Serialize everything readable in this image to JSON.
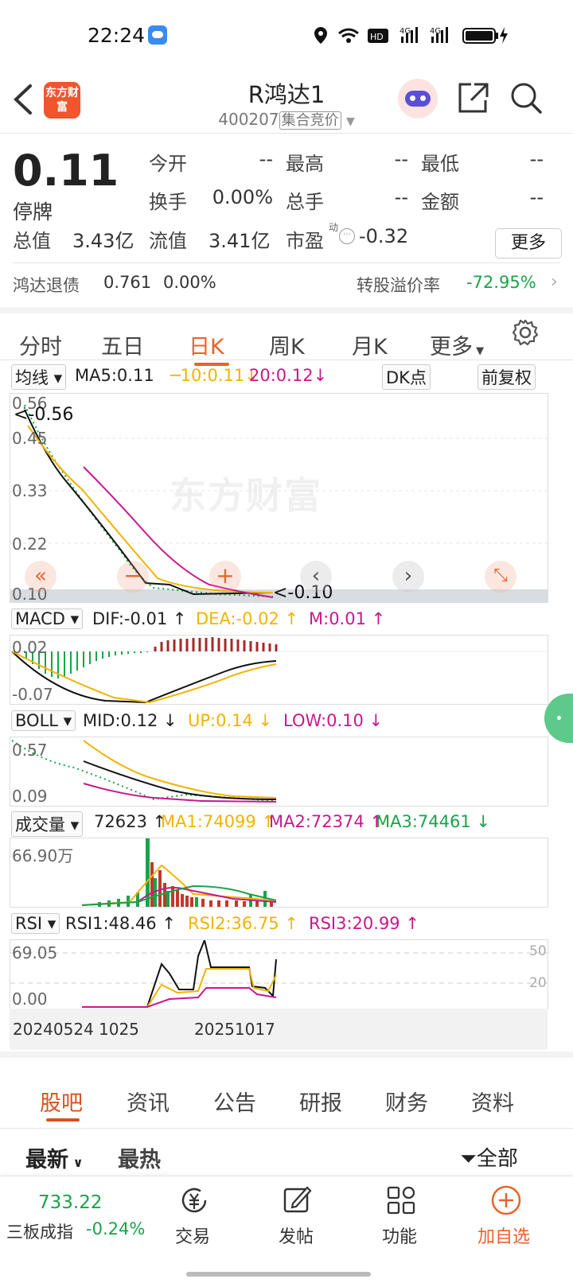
{
  "status_bar": {
    "time": "22:24"
  },
  "header": {
    "title": "R鸿达1",
    "code": "400207",
    "tag": "集合竞价",
    "logo_text": "东方财富"
  },
  "quote": {
    "price": "0.11",
    "state": "停牌",
    "open_label": "今开",
    "open": "--",
    "high_label": "最高",
    "high": "--",
    "low_label": "最低",
    "low": "--",
    "turnover_label": "换手",
    "turnover": "0.00%",
    "volume_label": "总手",
    "volume": "--",
    "amount_label": "金额",
    "amount": "--",
    "mktcap_label": "总值",
    "mktcap": "3.43亿",
    "float_label": "流值",
    "float": "3.41亿",
    "pe_label": "市盈",
    "pe_sup": "动",
    "pe": "-0.32",
    "more": "更多"
  },
  "bond": {
    "name": "鸿达退债",
    "price": "0.761",
    "change": "0.00%",
    "premium_label": "转股溢价率",
    "premium": "-72.95%"
  },
  "period_tabs": [
    "分时",
    "五日",
    "日K",
    "周K",
    "月K",
    "更多"
  ],
  "active_tab": 2,
  "main_chart": {
    "indicator": "均线",
    "ma5": "MA5:0.11",
    "ma10": "10:0.11",
    "ma20": "20:0.12",
    "dk": "DK点",
    "adjust": "前复权",
    "y_labels": [
      "0.56",
      "0.45",
      "0.33",
      "0.22",
      "0.10"
    ],
    "high_mark": "<-0.56",
    "low_mark": "<-0.10",
    "watermark": "东方财富"
  },
  "macd": {
    "name": "MACD",
    "dif": "DIF:-0.01",
    "dea": "DEA:-0.02",
    "m": "M:0.01",
    "y_top": "0.02",
    "y_bottom": "-0.07"
  },
  "boll": {
    "name": "BOLL",
    "mid": "MID:0.12",
    "up": "UP:0.14",
    "low": "LOW:0.10",
    "y_top": "0.57",
    "y_bottom": "0.09"
  },
  "vol": {
    "name": "成交量",
    "value": "72623",
    "ma1": "MA1:74099",
    "ma2": "MA2:72374",
    "ma3": "MA3:74461",
    "y_top": "66.90万"
  },
  "rsi": {
    "name": "RSI",
    "rsi1": "RSI1:48.46",
    "rsi2": "RSI2:36.75",
    "rsi3": "RSI3:20.99",
    "y_top": "69.05",
    "y_bottom": "0.00",
    "ref_high": "50",
    "ref_low": "20"
  },
  "x_axis": {
    "start": "20240524",
    "mid_fragment": "1025",
    "end": "20251017"
  },
  "content_tabs": [
    "股吧",
    "资讯",
    "公告",
    "研报",
    "财务",
    "资料"
  ],
  "sort": {
    "latest": "最新",
    "hot": "最热",
    "filter": "全部"
  },
  "bottom_bar": {
    "index_value": "733.22",
    "index_name": "三板成指",
    "index_change": "-0.24%",
    "trade": "交易",
    "post": "发帖",
    "functions": "功能",
    "add": "加自选"
  },
  "colors": {
    "accent": "#e8632b",
    "up": "#e0302d",
    "down": "#1aa34a",
    "yellow": "#f0b400",
    "magenta": "#c8188c"
  }
}
